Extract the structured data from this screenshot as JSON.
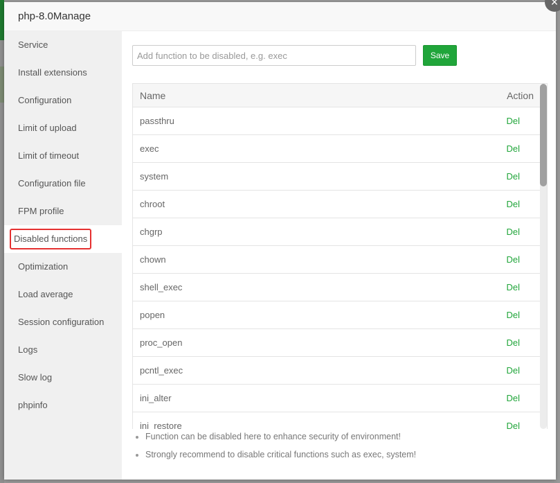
{
  "modal": {
    "title": "php-8.0Manage",
    "close_icon": "×"
  },
  "sidebar": {
    "items": [
      {
        "label": "Service"
      },
      {
        "label": "Install extensions"
      },
      {
        "label": "Configuration"
      },
      {
        "label": "Limit of upload"
      },
      {
        "label": "Limit of timeout"
      },
      {
        "label": "Configuration file"
      },
      {
        "label": "FPM profile"
      },
      {
        "label": "Disabled functions",
        "active": true
      },
      {
        "label": "Optimization"
      },
      {
        "label": "Load average"
      },
      {
        "label": "Session configuration"
      },
      {
        "label": "Logs"
      },
      {
        "label": "Slow log"
      },
      {
        "label": "phpinfo"
      }
    ]
  },
  "form": {
    "input_value": "",
    "input_placeholder": "Add function to be disabled, e.g. exec",
    "save_label": "Save"
  },
  "table": {
    "columns": [
      "Name",
      "Action"
    ],
    "rows": [
      {
        "name": "passthru",
        "action": "Del"
      },
      {
        "name": "exec",
        "action": "Del"
      },
      {
        "name": "system",
        "action": "Del"
      },
      {
        "name": "chroot",
        "action": "Del"
      },
      {
        "name": "chgrp",
        "action": "Del"
      },
      {
        "name": "chown",
        "action": "Del"
      },
      {
        "name": "shell_exec",
        "action": "Del"
      },
      {
        "name": "popen",
        "action": "Del"
      },
      {
        "name": "proc_open",
        "action": "Del"
      },
      {
        "name": "pcntl_exec",
        "action": "Del"
      },
      {
        "name": "ini_alter",
        "action": "Del"
      },
      {
        "name": "ini_restore",
        "action": "Del"
      }
    ]
  },
  "tips": [
    "Function can be disabled here to enhance security of environment!",
    "Strongly recommend to disable critical functions such as exec, system!"
  ],
  "colors": {
    "accent": "#20a53a",
    "highlight_border": "#e53030"
  }
}
